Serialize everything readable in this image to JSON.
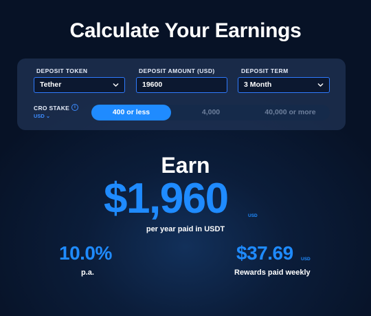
{
  "page": {
    "title": "Calculate Your Earnings"
  },
  "form": {
    "deposit_token": {
      "label": "DEPOSIT TOKEN",
      "value": "Tether",
      "icon": "chevron-down-icon"
    },
    "deposit_amount": {
      "label": "DEPOSIT AMOUNT (USD)",
      "value": "19600"
    },
    "deposit_term": {
      "label": "DEPOSIT TERM",
      "value": "3 Month",
      "icon": "chevron-down-icon"
    },
    "cro_stake": {
      "label": "CRO STAKE",
      "info_icon": "info-icon",
      "currency": "USD ⌄",
      "options": [
        "400 or less",
        "4,000",
        "40,000 or more"
      ],
      "selected": "400 or less"
    }
  },
  "result": {
    "earn_label": "Earn",
    "amount": "$1,960",
    "amount_unit": "USD",
    "period_text": "per year paid in USDT",
    "rate": "10.0%",
    "rate_label": "p.a.",
    "weekly_amount": "$37.69",
    "weekly_unit": "USD",
    "weekly_label": "Rewards paid weekly"
  },
  "colors": {
    "accent": "#1f8bff",
    "background": "#0b1d3a",
    "panel": "#22375a"
  }
}
